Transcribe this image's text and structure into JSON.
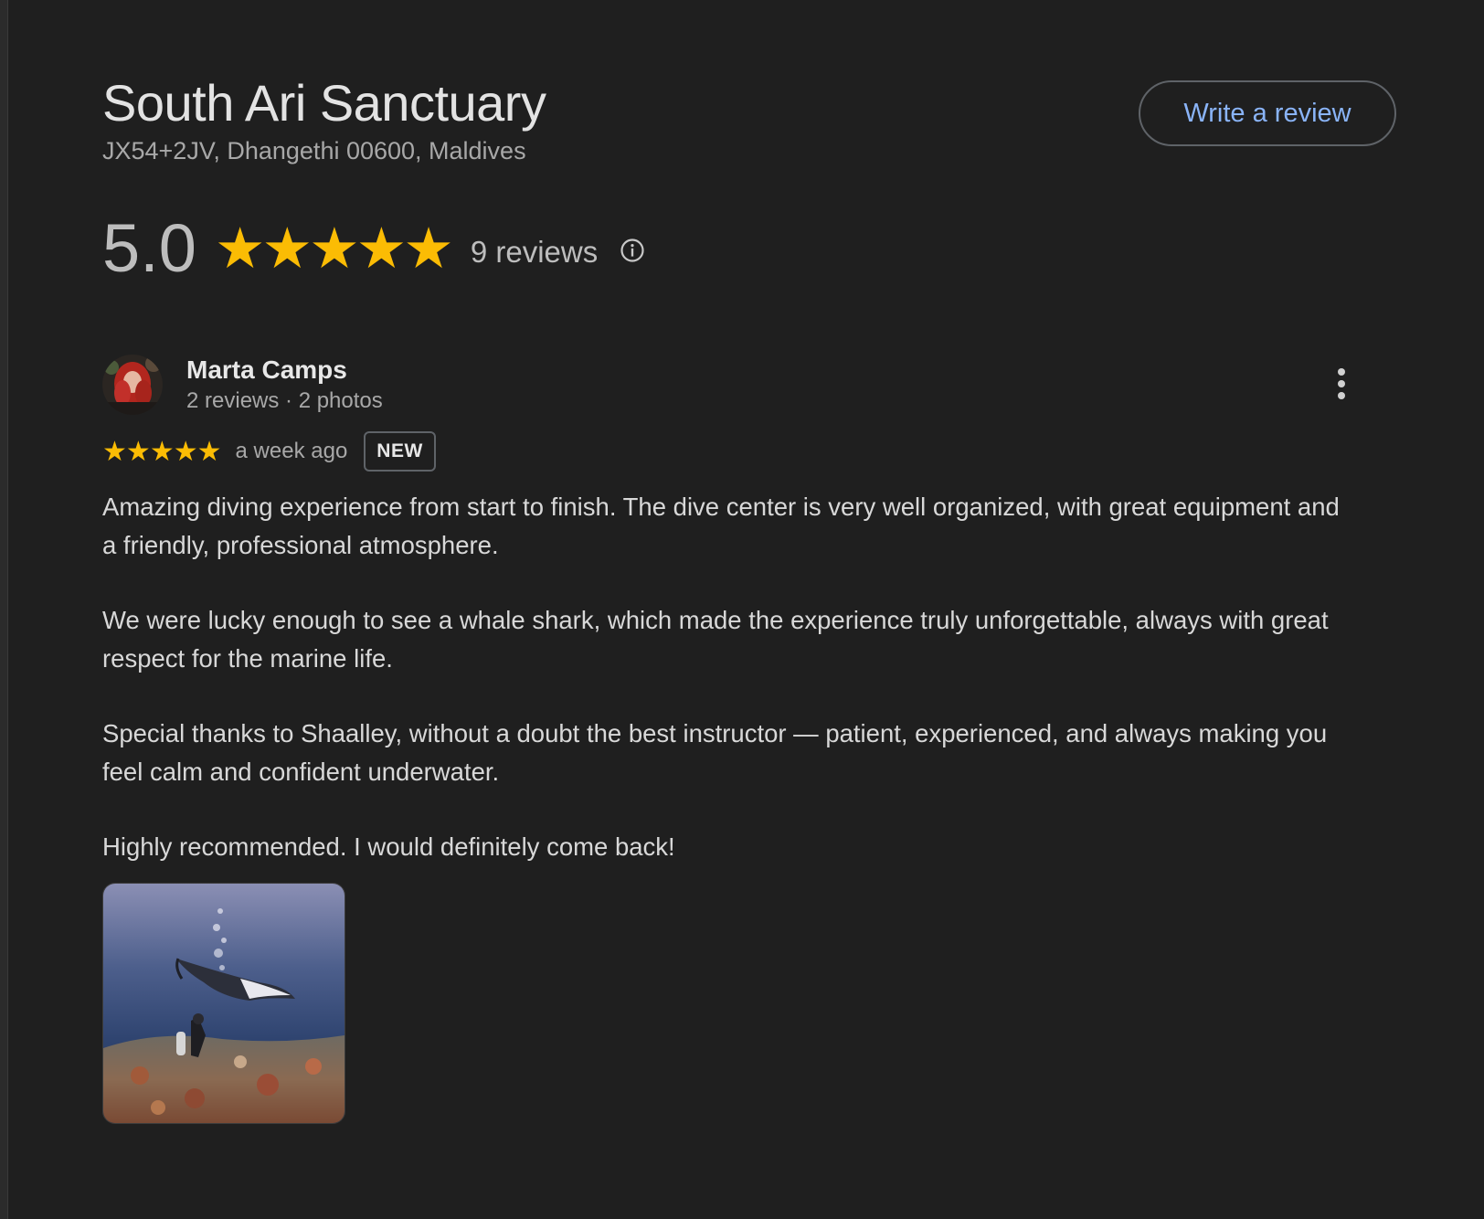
{
  "place": {
    "title": "South Ari Sanctuary",
    "address": "JX54+2JV, Dhangethi 00600, Maldives"
  },
  "actions": {
    "write_review_label": "Write a review"
  },
  "rating": {
    "score": "5.0",
    "stars": 5,
    "review_count": "9 reviews",
    "star_color": "#fbbc04"
  },
  "review": {
    "reviewer_name": "Marta Camps",
    "reviewer_meta": "2 reviews · 2 photos",
    "stars": 5,
    "time": "a week ago",
    "badge": "NEW",
    "paragraphs": [
      "Amazing diving experience from start to finish. The dive center is very well organized, with great equipment and a friendly, professional atmosphere.",
      "We were lucky enough to see a whale shark, which made the experience truly unforgettable, always with great respect for the marine life.",
      "Special thanks to Shaalley, without a doubt the best instructor — patient, experienced, and always making you feel calm and confident underwater.",
      "Highly recommended. I would definitely come back!"
    ],
    "photo_icon": "underwater-manta-photo"
  },
  "colors": {
    "background": "#1f1f1f",
    "accent_link": "#8ab4f8"
  }
}
